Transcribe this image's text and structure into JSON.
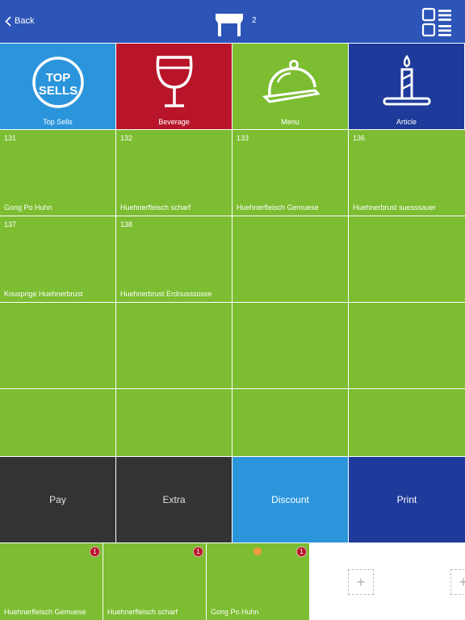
{
  "header": {
    "back_label": "Back",
    "table_number": "2"
  },
  "categories": [
    {
      "label": "Top Sells",
      "icon": "top-sells-icon",
      "color": "#2b95dc",
      "logo_text": [
        "TOP",
        "SELLS"
      ]
    },
    {
      "label": "Beverage",
      "icon": "wine-glass-icon",
      "color": "#b8152a"
    },
    {
      "label": "Menu",
      "icon": "cloche-icon",
      "color": "#7cbd31"
    },
    {
      "label": "Article",
      "icon": "candle-icon",
      "color": "#1e3a9a"
    }
  ],
  "items": [
    {
      "num": "131",
      "name": "Gong Po Huhn"
    },
    {
      "num": "132",
      "name": "Huehnerfleisch scharf"
    },
    {
      "num": "133",
      "name": "Huehnerfleisch Gemuese"
    },
    {
      "num": "136",
      "name": "Huehnerbrust suesssauer"
    },
    {
      "num": "137",
      "name": "Knusprige Huehnerbrust"
    },
    {
      "num": "138",
      "name": "Huehnerbrust Erdnusssosse"
    }
  ],
  "actions": [
    {
      "label": "Pay",
      "color": "#333333",
      "text_color": "#e0e0e0"
    },
    {
      "label": "Extra",
      "color": "#333333",
      "text_color": "#e0e0e0"
    },
    {
      "label": "Discount",
      "color": "#2b95dc",
      "text_color": "#ffffff"
    },
    {
      "label": "Print",
      "color": "#1e3a9a",
      "text_color": "#ffffff"
    }
  ],
  "order_items": [
    {
      "name": "Huehnerfleisch Gemuese",
      "qty": "1"
    },
    {
      "name": "Huehnerfleisch scharf",
      "qty": "1"
    },
    {
      "name": "Gong Po Huhn",
      "qty": "1",
      "status": "orange-dot"
    }
  ],
  "colors": {
    "header": "#2d55b8",
    "green": "#7cbd31"
  }
}
